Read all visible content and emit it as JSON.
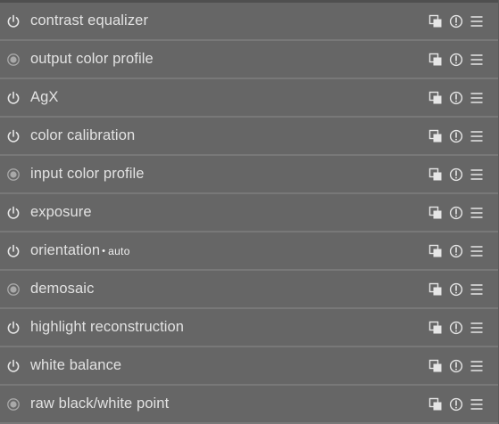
{
  "modules": [
    {
      "label": "contrast equalizer",
      "badge": "",
      "state": "on"
    },
    {
      "label": "output color profile",
      "badge": "",
      "state": "always-on"
    },
    {
      "label": "AgX",
      "badge": "",
      "state": "on"
    },
    {
      "label": "color calibration",
      "badge": "",
      "state": "on"
    },
    {
      "label": "input color profile",
      "badge": "",
      "state": "always-on"
    },
    {
      "label": "exposure",
      "badge": "",
      "state": "on"
    },
    {
      "label": "orientation",
      "badge": "auto",
      "state": "on"
    },
    {
      "label": "demosaic",
      "badge": "",
      "state": "always-on"
    },
    {
      "label": "highlight reconstruction",
      "badge": "",
      "state": "on"
    },
    {
      "label": "white balance",
      "badge": "",
      "state": "on"
    },
    {
      "label": "raw black/white point",
      "badge": "",
      "state": "always-on"
    }
  ],
  "icons": {
    "power": "power-icon",
    "always_on": "always-on-indicator-icon",
    "multi_instance": "multi-instance-icon",
    "reset": "reset-icon",
    "presets": "presets-menu-icon"
  },
  "colors": {
    "panel_bg": "#666666",
    "separator": "#787878",
    "text": "#e2e2e2",
    "icon": "#e6e6e6",
    "icon_dim": "#a8a8a8"
  }
}
